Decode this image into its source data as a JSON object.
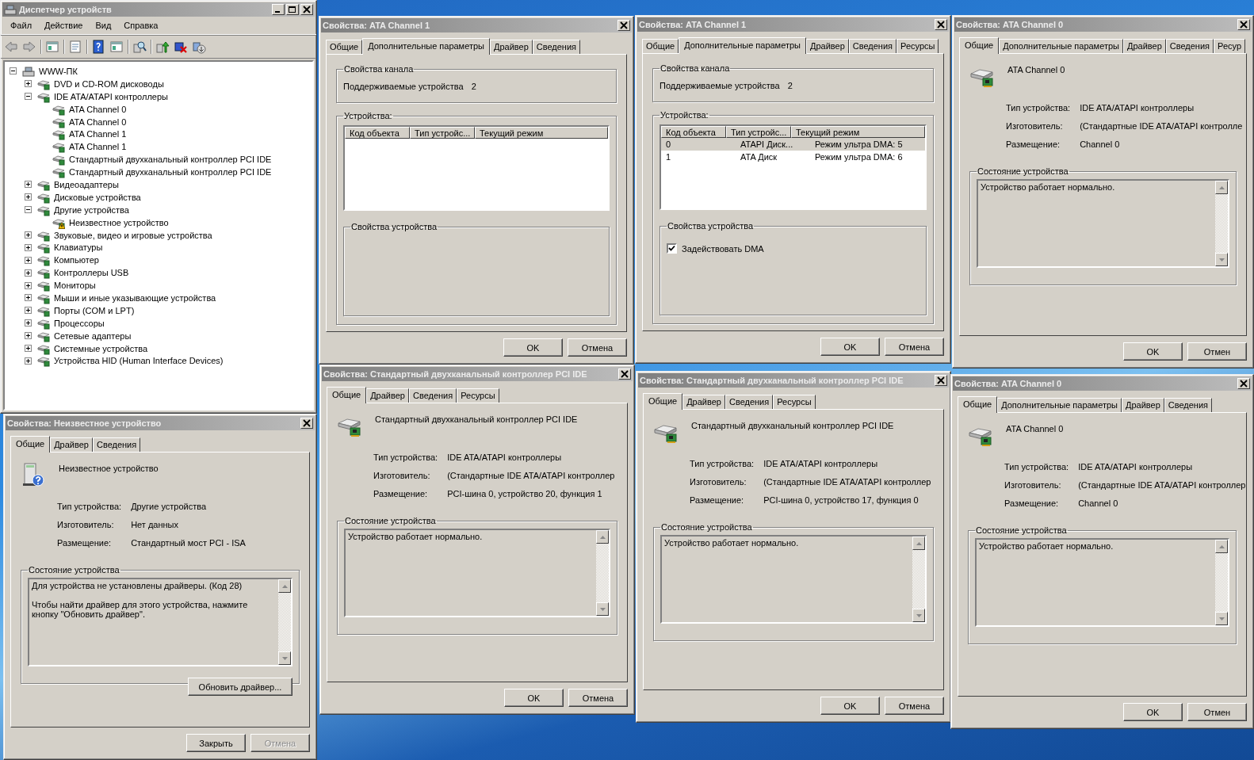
{
  "windows": [
    {
      "kind": "device_manager",
      "title": "Диспетчер устройств",
      "menu": [
        "Файл",
        "Действие",
        "Вид",
        "Справка"
      ],
      "tree": {
        "label": "WWW-ПК",
        "expanded": true,
        "children": [
          {
            "label": "DVD и CD-ROM дисководы",
            "expanded": false
          },
          {
            "label": "IDE ATA/ATAPI контроллеры",
            "expanded": true,
            "children": [
              {
                "label": "ATA Channel 0",
                "warning": false
              },
              {
                "label": "ATA Channel 0",
                "warning": false
              },
              {
                "label": "ATA Channel 1",
                "warning": false
              },
              {
                "label": "ATA Channel 1",
                "warning": false
              },
              {
                "label": "Стандартный двухканальный контроллер PCI IDE",
                "warning": false
              },
              {
                "label": "Стандартный двухканальный контроллер PCI IDE",
                "warning": false
              }
            ]
          },
          {
            "label": "Видеоадаптеры",
            "expanded": false
          },
          {
            "label": "Дисковые устройства",
            "expanded": false
          },
          {
            "label": "Другие устройства",
            "expanded": true,
            "children": [
              {
                "label": "Неизвестное устройство",
                "warning": true
              }
            ]
          },
          {
            "label": "Звуковые, видео и игровые устройства",
            "expanded": false
          },
          {
            "label": "Клавиатуры",
            "expanded": false
          },
          {
            "label": "Компьютер",
            "expanded": false
          },
          {
            "label": "Контроллеры USB",
            "expanded": false
          },
          {
            "label": "Мониторы",
            "expanded": false
          },
          {
            "label": "Мыши и иные указывающие устройства",
            "expanded": false
          },
          {
            "label": "Порты (COM и LPT)",
            "expanded": false
          },
          {
            "label": "Процессоры",
            "expanded": false
          },
          {
            "label": "Сетевые адаптеры",
            "expanded": false
          },
          {
            "label": "Системные устройства",
            "expanded": false
          },
          {
            "label": "Устройства HID (Human Interface Devices)",
            "expanded": false
          }
        ]
      }
    },
    {
      "kind": "properties",
      "title": "Свойства: Неизвестное устройство",
      "tabs": [
        {
          "label": "Общие",
          "selected": true
        },
        {
          "label": "Драйвер",
          "selected": false
        },
        {
          "label": "Сведения",
          "selected": false
        }
      ],
      "page": {
        "kind": "general",
        "unknown": true,
        "device_name": "Неизвестное устройство",
        "properties": [
          {
            "label": "Тип устройства:",
            "value": "Другие устройства"
          },
          {
            "label": "Изготовитель:",
            "value": "Нет данных"
          },
          {
            "label": "Размещение:",
            "value": "Стандартный мост PCI - ISA"
          }
        ],
        "status_group": {
          "title": "Состояние устройства",
          "paragraphs": [
            "Для устройства не установлены драйверы. (Код 28)",
            "Чтобы найти драйвер для этого устройства, нажмите кнопку \"Обновить драйвер\"."
          ]
        },
        "button": "Обновить драйвер..."
      },
      "buttons": [
        {
          "label": "Закрыть",
          "disabled": false
        },
        {
          "label": "Отмена",
          "disabled": true
        }
      ]
    },
    {
      "kind": "properties",
      "title": "Свойства: ATA Channel 1",
      "tabs": [
        {
          "label": "Общие",
          "selected": false
        },
        {
          "label": "Дополнительные параметры",
          "selected": true
        },
        {
          "label": "Драйвер",
          "selected": false
        },
        {
          "label": "Сведения",
          "selected": false
        }
      ],
      "page": {
        "kind": "advanced",
        "channel_group": {
          "title": "Свойства канала",
          "label": "Поддерживаемые устройства",
          "value": "2"
        },
        "devices_group": {
          "title": "Устройства:",
          "columns": [
            "Код объекта",
            "Тип устройс...",
            "Текущий режим"
          ]
        },
        "device_group": {
          "title": "Свойства устройства"
        }
      },
      "buttons": [
        {
          "label": "OK",
          "disabled": false
        },
        {
          "label": "Отмена",
          "disabled": false
        }
      ]
    },
    {
      "kind": "properties",
      "title": "Свойства: ATA Channel 1",
      "tabs": [
        {
          "label": "Общие",
          "selected": false
        },
        {
          "label": "Дополнительные параметры",
          "selected": true
        },
        {
          "label": "Драйвер",
          "selected": false
        },
        {
          "label": "Сведения",
          "selected": false
        },
        {
          "label": "Ресурсы",
          "selected": false
        }
      ],
      "page": {
        "kind": "advanced",
        "channel_group": {
          "title": "Свойства канала",
          "label": "Поддерживаемые устройства",
          "value": "2"
        },
        "devices_group": {
          "title": "Устройства:",
          "columns": [
            "Код объекта",
            "Тип устройс...",
            "Текущий режим"
          ],
          "rows": [
            {
              "cells": [
                "0",
                "ATAPI Диск...",
                "Режим ультра DMA: 5"
              ],
              "selected": true
            },
            {
              "cells": [
                "1",
                "ATA Диск",
                "Режим ультра DMA: 6"
              ],
              "selected": false
            }
          ]
        },
        "device_group": {
          "title": "Свойства устройства",
          "checkbox": {
            "label": "Задействовать DMA",
            "checked": true
          }
        }
      },
      "buttons": [
        {
          "label": "OK",
          "disabled": false
        },
        {
          "label": "Отмена",
          "disabled": false
        }
      ]
    },
    {
      "kind": "properties",
      "title": "Свойства: ATA Channel 0",
      "tabs": [
        {
          "label": "Общие",
          "selected": true
        },
        {
          "label": "Дополнительные параметры",
          "selected": false
        },
        {
          "label": "Драйвер",
          "selected": false
        },
        {
          "label": "Сведения",
          "selected": false
        },
        {
          "label": "Ресур",
          "selected": false
        }
      ],
      "page": {
        "kind": "general",
        "unknown": false,
        "device_name": "ATA Channel 0",
        "properties": [
          {
            "label": "Тип устройства:",
            "value": "IDE ATA/ATAPI контроллеры"
          },
          {
            "label": "Изготовитель:",
            "value": "(Стандартные IDE ATA/ATAPI контролле"
          },
          {
            "label": "Размещение:",
            "value": "Channel 0"
          }
        ],
        "status_group": {
          "title": "Состояние устройства",
          "paragraphs": [
            "Устройство работает нормально."
          ]
        }
      },
      "buttons": [
        {
          "label": "OK",
          "disabled": false
        },
        {
          "label": "Отмен",
          "disabled": false
        }
      ]
    },
    {
      "kind": "properties",
      "title": "Свойства: Стандартный двухканальный контроллер PCI IDE",
      "tabs": [
        {
          "label": "Общие",
          "selected": true
        },
        {
          "label": "Драйвер",
          "selected": false
        },
        {
          "label": "Сведения",
          "selected": false
        },
        {
          "label": "Ресурсы",
          "selected": false
        }
      ],
      "page": {
        "kind": "general",
        "unknown": false,
        "device_name": "Стандартный двухканальный контроллер PCI IDE",
        "properties": [
          {
            "label": "Тип устройства:",
            "value": "IDE ATA/ATAPI контроллеры"
          },
          {
            "label": "Изготовитель:",
            "value": "(Стандартные IDE ATA/ATAPI контроллер"
          },
          {
            "label": "Размещение:",
            "value": "PCI-шина 0, устройство 20, функция 1"
          }
        ],
        "status_group": {
          "title": "Состояние устройства",
          "paragraphs": [
            "Устройство работает нормально."
          ]
        }
      },
      "buttons": [
        {
          "label": "OK",
          "disabled": false
        },
        {
          "label": "Отмена",
          "disabled": false
        }
      ]
    },
    {
      "kind": "properties",
      "title": "Свойства: Стандартный двухканальный контроллер PCI IDE",
      "tabs": [
        {
          "label": "Общие",
          "selected": true
        },
        {
          "label": "Драйвер",
          "selected": false
        },
        {
          "label": "Сведения",
          "selected": false
        },
        {
          "label": "Ресурсы",
          "selected": false
        }
      ],
      "page": {
        "kind": "general",
        "unknown": false,
        "device_name": "Стандартный двухканальный контроллер PCI IDE",
        "properties": [
          {
            "label": "Тип устройства:",
            "value": "IDE ATA/ATAPI контроллеры"
          },
          {
            "label": "Изготовитель:",
            "value": "(Стандартные IDE ATA/ATAPI контроллер"
          },
          {
            "label": "Размещение:",
            "value": "PCI-шина 0, устройство 17, функция 0"
          }
        ],
        "status_group": {
          "title": "Состояние устройства",
          "paragraphs": [
            "Устройство работает нормально."
          ]
        }
      },
      "buttons": [
        {
          "label": "OK",
          "disabled": false
        },
        {
          "label": "Отмена",
          "disabled": false
        }
      ]
    },
    {
      "kind": "properties",
      "title": "Свойства: ATA Channel 0",
      "tabs": [
        {
          "label": "Общие",
          "selected": true
        },
        {
          "label": "Дополнительные параметры",
          "selected": false
        },
        {
          "label": "Драйвер",
          "selected": false
        },
        {
          "label": "Сведения",
          "selected": false
        }
      ],
      "page": {
        "kind": "general",
        "unknown": false,
        "device_name": "ATA Channel 0",
        "properties": [
          {
            "label": "Тип устройства:",
            "value": "IDE ATA/ATAPI контроллеры"
          },
          {
            "label": "Изготовитель:",
            "value": "(Стандартные IDE ATA/ATAPI контроллер"
          },
          {
            "label": "Размещение:",
            "value": "Channel 0"
          }
        ],
        "status_group": {
          "title": "Состояние устройства",
          "paragraphs": [
            "Устройство работает нормально."
          ]
        }
      },
      "buttons": [
        {
          "label": "OK",
          "disabled": false
        },
        {
          "label": "Отмен",
          "disabled": false
        }
      ]
    }
  ]
}
